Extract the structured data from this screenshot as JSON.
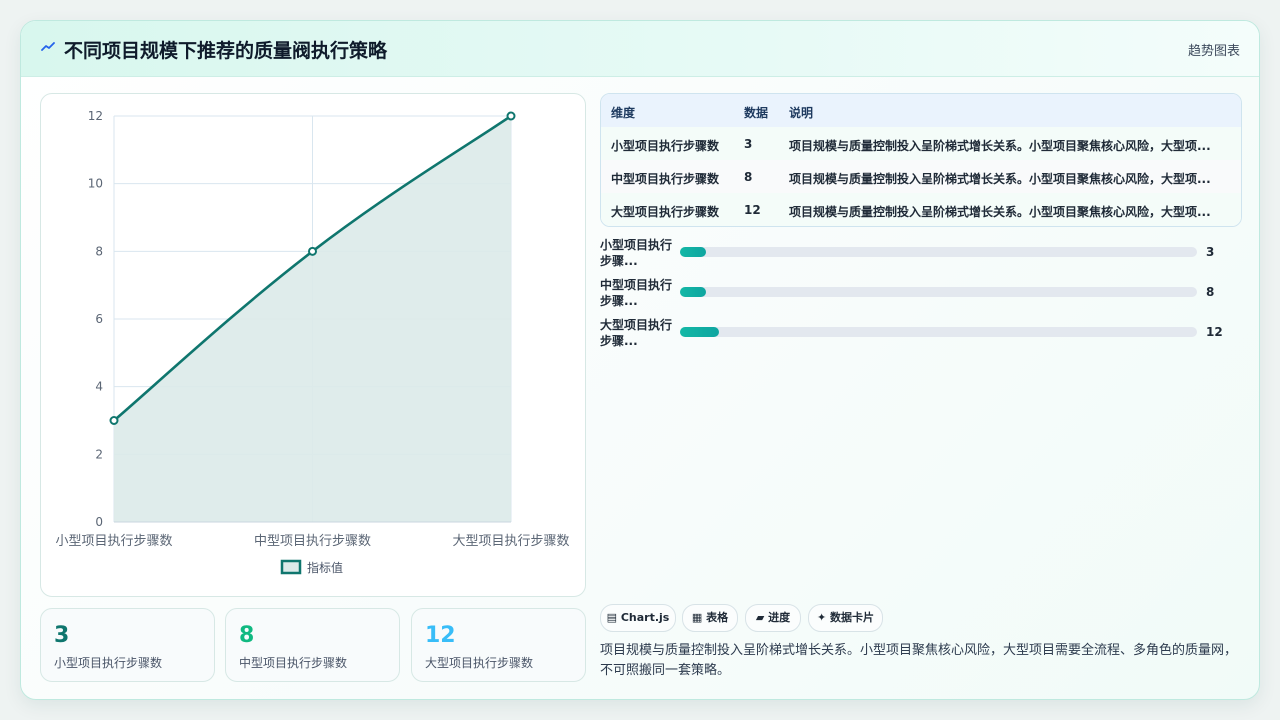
{
  "header": {
    "title": "不同项目规模下推荐的质量阀执行策略",
    "tag": "趋势图表"
  },
  "chart_data": {
    "type": "area",
    "categories": [
      "小型项目执行步骤数",
      "中型项目执行步骤数",
      "大型项目执行步骤数"
    ],
    "series": [
      {
        "name": "指标值",
        "values": [
          3,
          8,
          12
        ]
      }
    ],
    "ylim": [
      0,
      12
    ],
    "yticks": [
      0,
      2,
      4,
      6,
      8,
      10,
      12
    ],
    "grid": true,
    "legend": "bottom",
    "colors": {
      "line": "#0f766e",
      "fill": "#dceae9"
    }
  },
  "tiles": [
    {
      "value": "3",
      "label": "小型项目执行步骤数",
      "color": "#0f766e"
    },
    {
      "value": "8",
      "label": "中型项目执行步骤数",
      "color": "#10b981"
    },
    {
      "value": "12",
      "label": "大型项目执行步骤数",
      "color": "#38bdf8"
    }
  ],
  "table": {
    "headers": [
      "维度",
      "数据",
      "说明"
    ],
    "rows": [
      [
        "小型项目执行步骤数",
        "3",
        "项目规模与质量控制投入呈阶梯式增长关系。小型项目聚焦核心风险，大型项..."
      ],
      [
        "中型项目执行步骤数",
        "8",
        "项目规模与质量控制投入呈阶梯式增长关系。小型项目聚焦核心风险，大型项..."
      ],
      [
        "大型项目执行步骤数",
        "12",
        "项目规模与质量控制投入呈阶梯式增长关系。小型项目聚焦核心风险，大型项..."
      ]
    ]
  },
  "progress": [
    {
      "label": "小型项目执行步骤...",
      "value": "3",
      "fraction": 0.05
    },
    {
      "label": "中型项目执行步骤...",
      "value": "8",
      "fraction": 0.05
    },
    {
      "label": "大型项目执行步骤...",
      "value": "12",
      "fraction": 0.075
    }
  ],
  "chips": [
    "▤ Chart.js",
    "▦ 表格",
    "▰ 进度",
    "✦ 数据卡片"
  ],
  "summary": "项目规模与质量控制投入呈阶梯式增长关系。小型项目聚焦核心风险，大型项目需要全流程、多角色的质量网，不可照搬同一套策略。"
}
